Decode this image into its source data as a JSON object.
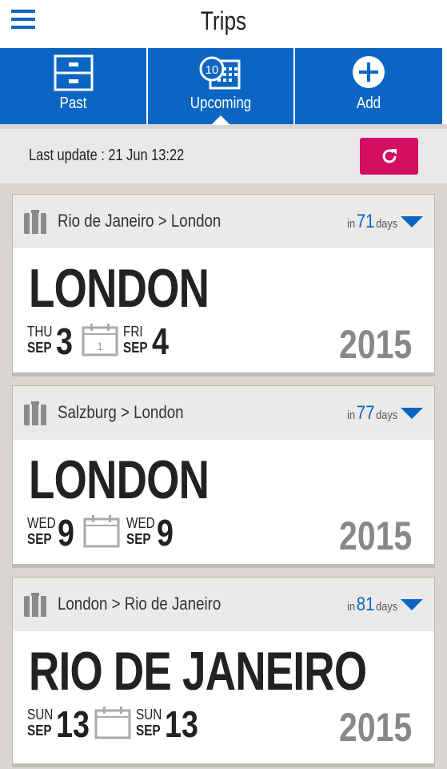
{
  "header": {
    "title": "Trips",
    "menu_icon": "hamburger-menu-icon"
  },
  "tabs": [
    {
      "label": "Past",
      "icon": "drawer-cabinet-icon",
      "active": false
    },
    {
      "label": "Upcoming",
      "icon": "calendar-10-icon",
      "active": true
    },
    {
      "label": "Add",
      "icon": "plus-circle-icon",
      "active": false
    }
  ],
  "update": {
    "text": "Last update : 21 Jun 13:22",
    "refresh_icon": "refresh-icon"
  },
  "colors": {
    "primary": "#0a66c2",
    "accent": "#d40e63",
    "background": "#d9d5d0"
  },
  "trips": [
    {
      "route": "Rio de Janeiro > London",
      "in": "in",
      "days_num": "71",
      "days": "days",
      "city": "LONDON",
      "start": {
        "dow": "THU",
        "mon": "SEP",
        "day": "3"
      },
      "nights": "1",
      "end": {
        "dow": "FRI",
        "mon": "SEP",
        "day": "4"
      },
      "year": "2015"
    },
    {
      "route": "Salzburg > London",
      "in": "in",
      "days_num": "77",
      "days": "days",
      "city": "LONDON",
      "start": {
        "dow": "WED",
        "mon": "SEP",
        "day": "9"
      },
      "nights": "",
      "end": {
        "dow": "WED",
        "mon": "SEP",
        "day": "9"
      },
      "year": "2015"
    },
    {
      "route": "London > Rio de Janeiro",
      "in": "in",
      "days_num": "81",
      "days": "days",
      "city": "RIO DE JANEIRO",
      "start": {
        "dow": "SUN",
        "mon": "SEP",
        "day": "13"
      },
      "nights": "",
      "end": {
        "dow": "SUN",
        "mon": "SEP",
        "day": "13"
      },
      "year": "2015"
    }
  ]
}
